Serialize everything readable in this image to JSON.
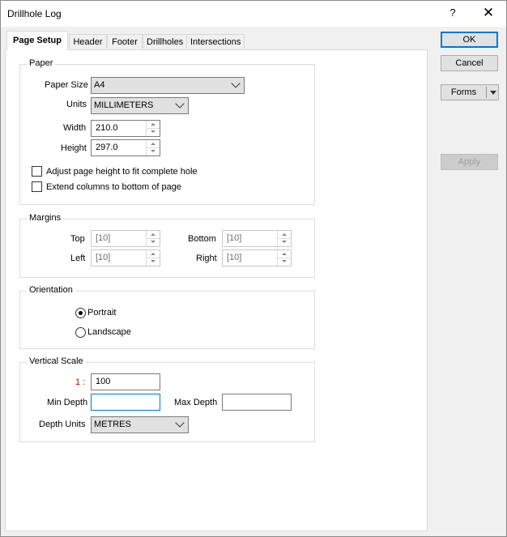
{
  "window": {
    "title": "Drillhole Log",
    "help": "?",
    "close": "✕"
  },
  "tabs": [
    {
      "label": "Page Setup"
    },
    {
      "label": "Header"
    },
    {
      "label": "Footer"
    },
    {
      "label": "Drillholes"
    },
    {
      "label": "Intersections"
    }
  ],
  "paper": {
    "group_title": "Paper",
    "paper_size_label": "Paper Size",
    "paper_size_value": "A4",
    "units_label": "Units",
    "units_value": "MILLIMETERS",
    "width_label": "Width",
    "width_value": "210.0",
    "height_label": "Height",
    "height_value": "297.0",
    "adjust_label": "Adjust page height to fit complete hole",
    "extend_label": "Extend columns to bottom of page"
  },
  "margins": {
    "group_title": "Margins",
    "top_label": "Top",
    "top_value": "[10]",
    "bottom_label": "Bottom",
    "bottom_value": "[10]",
    "left_label": "Left",
    "left_value": "[10]",
    "right_label": "Right",
    "right_value": "[10]"
  },
  "orientation": {
    "group_title": "Orientation",
    "portrait_label": "Portrait",
    "landscape_label": "Landscape",
    "selected": "Portrait"
  },
  "vertical_scale": {
    "group_title": "Vertical Scale",
    "ratio_label": "1 :",
    "ratio_value": "100",
    "min_depth_label": "Min Depth",
    "min_depth_value": "",
    "max_depth_label": "Max Depth",
    "max_depth_value": "",
    "depth_units_label": "Depth Units",
    "depth_units_value": "METRES"
  },
  "buttons": {
    "ok": "OK",
    "cancel": "Cancel",
    "forms": "Forms",
    "apply": "Apply"
  },
  "colors": {
    "accent": "#0078d7",
    "ratio_label": "#c00000"
  }
}
